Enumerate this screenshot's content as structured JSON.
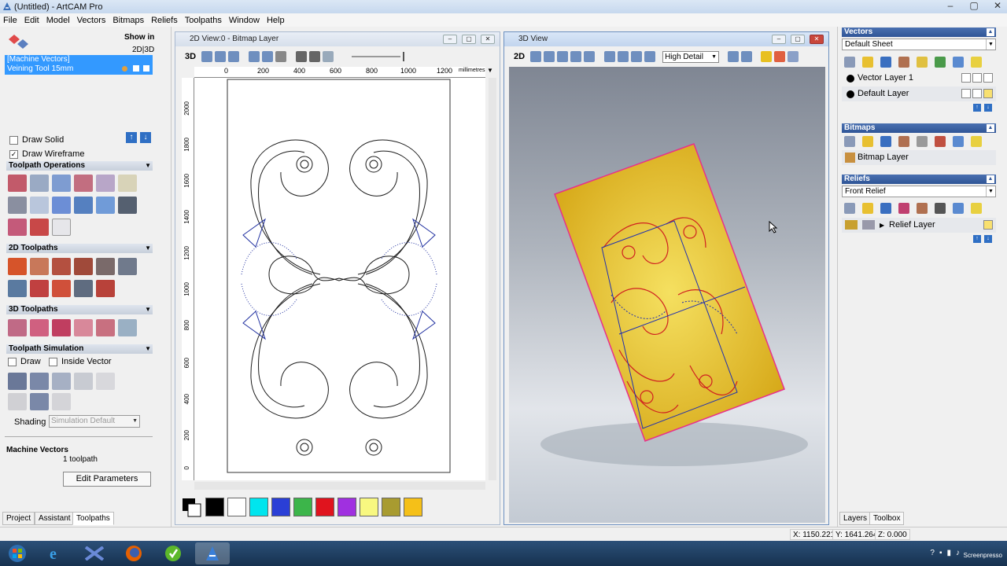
{
  "window": {
    "title": "(Untitled) - ArtCAM Pro",
    "controls": [
      "–",
      "▢",
      "✕"
    ]
  },
  "menu": [
    "File",
    "Edit",
    "Model",
    "Vectors",
    "Bitmaps",
    "Reliefs",
    "Toolpaths",
    "Window",
    "Help"
  ],
  "left": {
    "show_in": "Show in",
    "mode": "2D|3D",
    "selected_line1": "[Machine Vectors]",
    "selected_line2": "Veining Tool 15mm",
    "draw_solid": "Draw Solid",
    "draw_wireframe": "Draw Wireframe",
    "sections": {
      "toolpath_ops": "Toolpath Operations",
      "toolpaths_2d": "2D Toolpaths",
      "toolpaths_3d": "3D Toolpaths",
      "simulation": "Toolpath Simulation"
    },
    "sim_draw": "Draw",
    "sim_inside": "Inside Vector",
    "shading_label": "Shading",
    "shading_value": "Simulation Default",
    "machine_vectors": "Machine Vectors",
    "toolpath_count": "1 toolpath",
    "edit_parameters": "Edit Parameters",
    "tabs": [
      "Project",
      "Assistant",
      "Toolpaths"
    ]
  },
  "view2d": {
    "title": "2D View:0 - Bitmap Layer",
    "mode_label": "3D",
    "ruler_h": [
      "0",
      "200",
      "400",
      "600",
      "800",
      "1000",
      "1200"
    ],
    "units": "millimetres",
    "ruler_v": [
      "2000",
      "1800",
      "1600",
      "1400",
      "1200",
      "1000",
      "800",
      "600",
      "400",
      "200",
      "0"
    ],
    "palette": [
      "#000000",
      "#ffffff",
      "#00e5ee",
      "#2a3fd6",
      "#3cb54a",
      "#e0141e",
      "#a030e0",
      "#f8f880",
      "#a89b30",
      "#f5c018"
    ]
  },
  "view3d": {
    "title": "3D View",
    "mode_label": "2D",
    "detail": "High Detail"
  },
  "right": {
    "vectors": "Vectors",
    "sheet": "Default Sheet",
    "vector_layers": [
      "Vector Layer 1",
      "Default Layer"
    ],
    "bitmaps": "Bitmaps",
    "bitmap_layer": "Bitmap Layer",
    "reliefs": "Reliefs",
    "relief": "Front Relief",
    "relief_layer": "Relief Layer",
    "tabs": [
      "Layers",
      "Toolbox"
    ]
  },
  "status": {
    "x": "X: 1150.221",
    "y": "Y: 1641.264",
    "z": "Z: 0.000"
  },
  "taskbar": {
    "apps": [
      "start-orb",
      "internet-explorer",
      "mail-client",
      "firefox",
      "media-app",
      "artcam"
    ],
    "tray_text": "Screenpresso"
  }
}
